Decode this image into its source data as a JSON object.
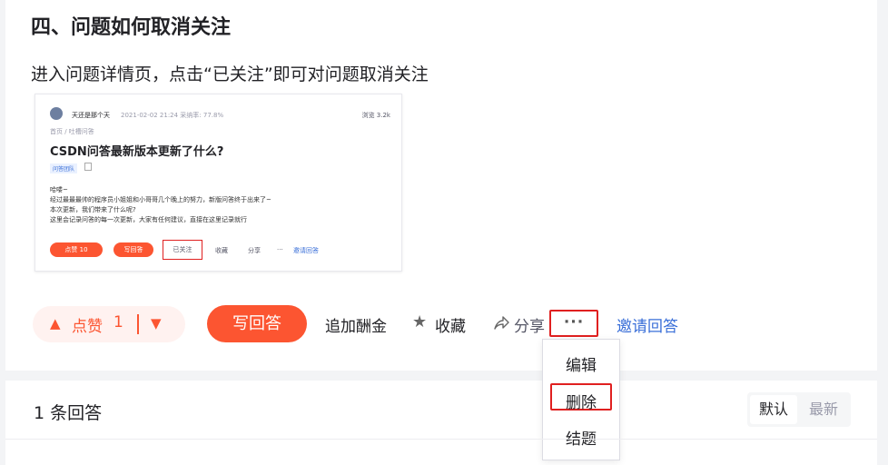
{
  "section_title": "四、问题如何取消关注",
  "intro_text": "进入问题详情页，点击“已关注”即可对问题取消关注",
  "embedded_screenshot": {
    "author": "天还是那个天",
    "meta": "2021-02-02 21:24  采纳率: 77.8%",
    "views": "浏览 3.2k",
    "breadcrumb": "首页 / 吐槽问答",
    "question_title": "CSDN问答最新版本更新了什么?",
    "tag": "问答团队",
    "body_lines": [
      "哈喽~",
      "经过最最最帅的程序员小姐姐和小哥哥几个晚上的努力，新版问答终于出来了~",
      "本次更新，我们带来了什么呢?",
      "这里会记录问答的每一次更新，大家有任何建议，直接在这里记录就行"
    ],
    "like_label": "点赞 10",
    "write_label": "写回答",
    "followed_label": "已关注",
    "collect_label": "收藏",
    "share_label": "分享",
    "more_label": "···",
    "invite_label": "邀请回答"
  },
  "action_bar": {
    "like_label": "点赞",
    "like_count": "1",
    "write_answer": "写回答",
    "add_reward": "追加酬金",
    "collect": "收藏",
    "share": "分享",
    "more": "···",
    "invite_answer": "邀请回答"
  },
  "dropdown": {
    "items": [
      "编辑",
      "删除",
      "结题"
    ]
  },
  "answers_section": {
    "count_label": "1 条回答",
    "sort_default": "默认",
    "sort_newest": "最新"
  },
  "colors": {
    "brand": "#fc5531",
    "highlight_border": "#e02020",
    "link": "#3a6fd8"
  }
}
